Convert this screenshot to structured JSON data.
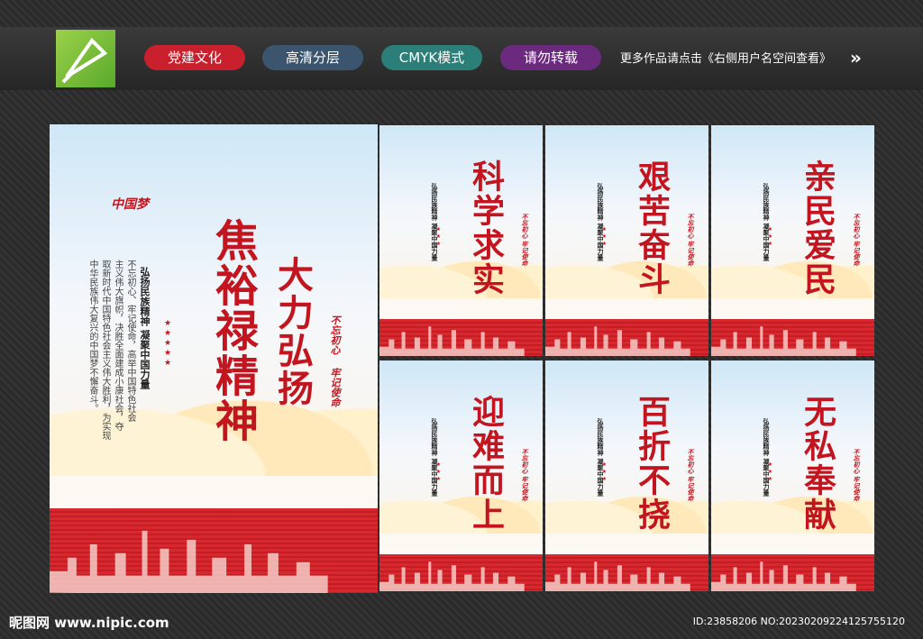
{
  "header": {
    "tags": [
      "党建文化",
      "高清分层",
      "CMYK模式",
      "请勿转载"
    ],
    "notice": "更多作品请点击《右侧用户名空间查看》"
  },
  "main_poster": {
    "title": "焦裕禄精神",
    "subtitle": "大力弘扬",
    "slogan1": "不忘初心",
    "slogan2": "牢记使命",
    "heading": "弘扬民族精神 凝聚中国力量",
    "body1": "不忘初心、牢记使命，高举中国特色社会",
    "body2": "主义伟大旗帜，决胜全面建成小康社会，夺",
    "body3": "取新时代中国特色社会主义伟大胜利，为实现",
    "body4": "中华民族伟大复兴的中国梦不懈奋斗。",
    "logo_text": "中国梦"
  },
  "small_posters": [
    {
      "title": "科学求实"
    },
    {
      "title": "艰苦奋斗"
    },
    {
      "title": "亲民爱民"
    },
    {
      "title": "迎难而上"
    },
    {
      "title": "百折不挠"
    },
    {
      "title": "无私奉献"
    }
  ],
  "small_common": {
    "slogan": "不忘初心 牢记使命",
    "heading": "弘扬民族精神 凝聚中国力量"
  },
  "footer": {
    "site": "昵图网 www.nipic.com",
    "id": "ID:23858206 NO:20230209224125755120"
  },
  "colors": {
    "accent": "#c3151f"
  }
}
